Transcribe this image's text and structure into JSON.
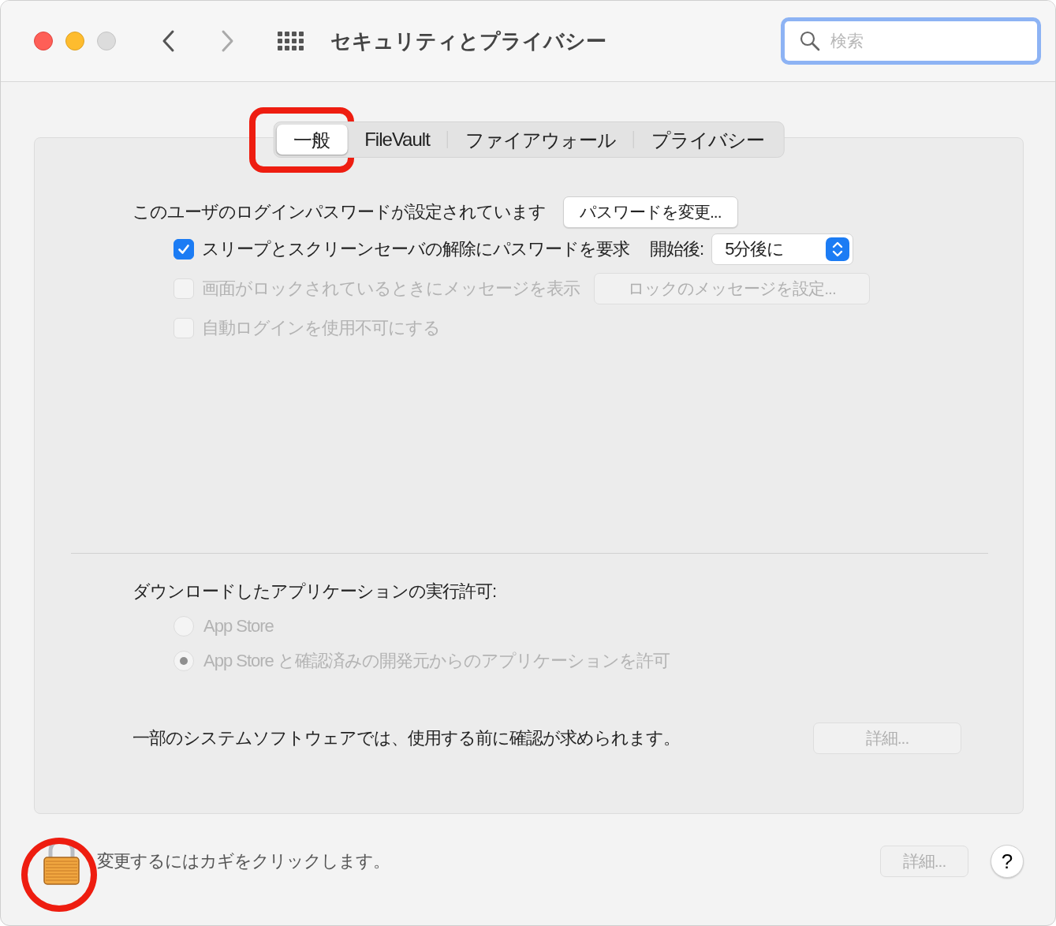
{
  "window": {
    "title": "セキュリティとプライバシー"
  },
  "search": {
    "placeholder": "検索",
    "focused": true
  },
  "tabs": [
    {
      "label": "一般",
      "selected": true
    },
    {
      "label": "FileVault",
      "selected": false
    },
    {
      "label": "ファイアウォール",
      "selected": false
    },
    {
      "label": "プライバシー",
      "selected": false
    }
  ],
  "general": {
    "password_text": "このユーザのログインパスワードが設定されています",
    "change_password_button": "パスワードを変更...",
    "options": [
      {
        "label": "スリープとスクリーンセーバの解除にパスワードを要求",
        "checked": true,
        "disabled": false,
        "delay_label": "開始後:",
        "delay_value": "5分後に"
      },
      {
        "label": "画面がロックされているときにメッセージを表示",
        "checked": false,
        "disabled": true,
        "button": "ロックのメッセージを設定..."
      },
      {
        "label": "自動ログインを使用不可にする",
        "checked": false,
        "disabled": true
      }
    ]
  },
  "downloads": {
    "label": "ダウンロードしたアプリケーションの実行許可:",
    "options": [
      {
        "label": "App Store",
        "selected": false,
        "disabled": true
      },
      {
        "label": "App Store と確認済みの開発元からのアプリケーションを許可",
        "selected": true,
        "disabled": true
      }
    ]
  },
  "system_software": {
    "text": "一部のシステムソフトウェアでは、使用する前に確認が求められます。",
    "button": {
      "label": "詳細...",
      "disabled": true
    }
  },
  "footer": {
    "lock_text": "変更するにはカギをクリックします。",
    "advanced_button": {
      "label": "詳細...",
      "disabled": true
    },
    "help_button": "?"
  }
}
